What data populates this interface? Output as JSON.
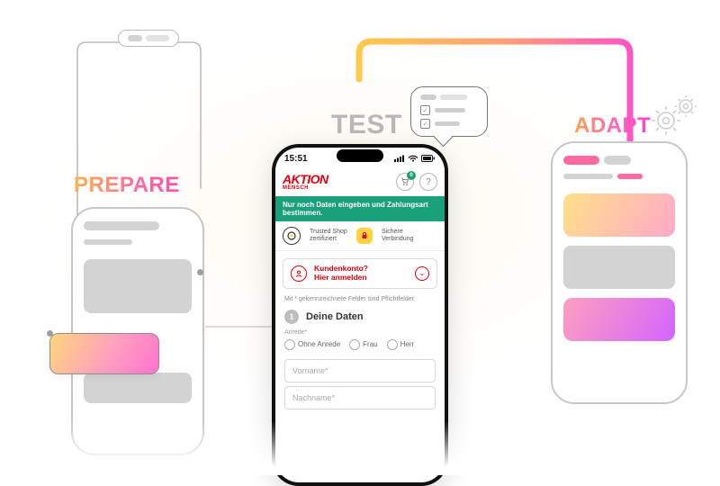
{
  "stages": {
    "prepare": "PREPARE",
    "test": "TEST",
    "adapt": "ADAPT"
  },
  "phone": {
    "time": "15:51",
    "logo_main": "AKTION",
    "logo_sub": "MENSCH",
    "cart_badge": "0",
    "help_glyph": "?",
    "banner": "Nur noch Daten eingeben und Zahlungsart bestimmen.",
    "trust1": "Trusted Shop zertifiziert",
    "trust2": "Sichere Verbindung",
    "account_l1": "Kundenkonto?",
    "account_l2": "Hier anmelden",
    "required_note": "Mit * gekennzeichnete Felder sind Pflichtfelder.",
    "step_num": "1",
    "section": "Deine Daten",
    "anrede_label": "Anrede*",
    "radio1": "Ohne Anrede",
    "radio2": "Frau",
    "radio3": "Herr",
    "vorname": "Vorname*",
    "nachname": "Nachname*"
  }
}
